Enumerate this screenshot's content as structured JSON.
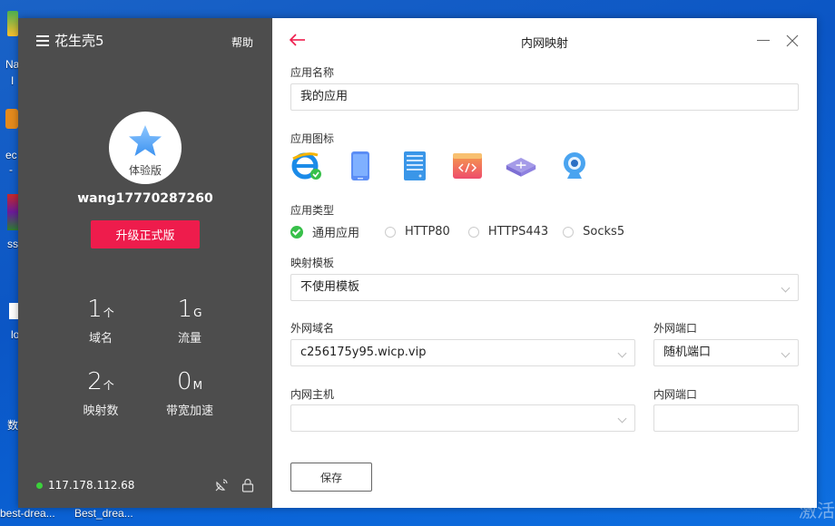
{
  "desktop": {
    "icon_labels": [
      "Na",
      "I",
      "ec",
      "-",
      "ss",
      "lo",
      "数"
    ],
    "taskbar_items": [
      "best-drea...",
      "Best_drea..."
    ],
    "watermark": "激活"
  },
  "sidebar": {
    "title": "花生壳5",
    "help": "帮助",
    "avatar_label": "体验版",
    "username": "wang17770287260",
    "upgrade_label": "升级正式版",
    "stats": [
      {
        "value": "1",
        "unit": "个",
        "label": "域名"
      },
      {
        "value": "1",
        "unit": "G",
        "label": "流量"
      },
      {
        "value": "2",
        "unit": "个",
        "label": "映射数"
      },
      {
        "value": "0",
        "unit": "M",
        "label": "带宽加速"
      }
    ],
    "ip": "117.178.112.68",
    "status_color": "#3bd13b"
  },
  "main": {
    "title": "内网映射",
    "app_name_label": "应用名称",
    "app_name_value": "我的应用",
    "app_icon_label": "应用图标",
    "app_icons": [
      "ie-icon",
      "phone-icon",
      "server-icon",
      "code-icon",
      "router-icon",
      "webcam-icon"
    ],
    "app_type_label": "应用类型",
    "app_types": [
      "通用应用",
      "HTTP80",
      "HTTPS443",
      "Socks5"
    ],
    "selected_app_type": "通用应用",
    "template_label": "映射模板",
    "template_value": "不使用模板",
    "domain_label": "外网域名",
    "domain_value": "c256175y95.wicp.vip",
    "ext_port_label": "外网端口",
    "ext_port_value": "随机端口",
    "host_label": "内网主机",
    "host_value": "",
    "int_port_label": "内网端口",
    "int_port_value": "",
    "save_label": "保存",
    "accent_color": "#ee1c4c"
  }
}
